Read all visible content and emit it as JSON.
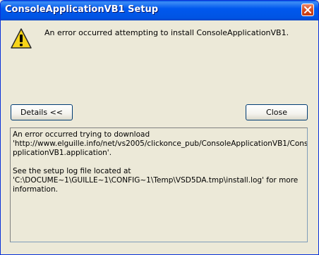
{
  "window": {
    "title": "ConsoleApplicationVB1 Setup"
  },
  "icons": {
    "status": "warning-icon",
    "close": "close-icon"
  },
  "message": "An error occurred attempting to install ConsoleApplicationVB1.",
  "buttons": {
    "details": "Details <<",
    "close": "Close"
  },
  "details": {
    "lines": [
      "An error occurred trying to download",
      "'http://www.elguille.info/net/vs2005/clickonce_pub/ConsoleApplicationVB1/ConsoleA",
      "pplicationVB1.application'.",
      "See the setup log file located at",
      "'C:\\DOCUME~1\\GUILLE~1\\CONFIG~1\\Temp\\VSD5DA.tmp\\install.log' for more",
      "information."
    ]
  },
  "colors": {
    "titlebar": "#0054e3",
    "window_bg": "#ece9d8",
    "close_button": "#d5491e",
    "warning_yellow": "#f7d417"
  }
}
